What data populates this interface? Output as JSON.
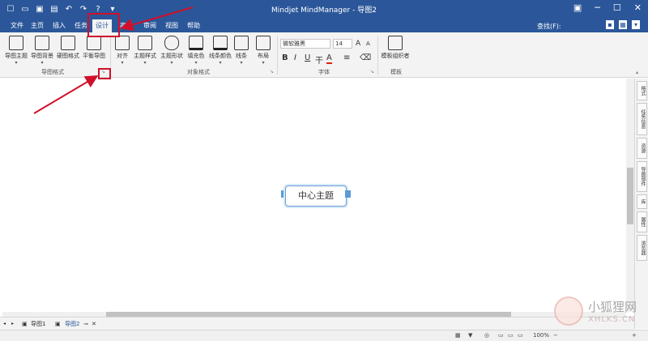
{
  "app": {
    "title": "Mindjet MindManager - 导图2"
  },
  "tabs": [
    "文件",
    "主页",
    "插入",
    "任务",
    "设计",
    "高级",
    "审阅",
    "视图",
    "帮助"
  ],
  "active_tab": "设计",
  "find_label": "查找(F):",
  "ribbon": {
    "buttons": [
      "导图主题",
      "导图背景",
      "硬图格式",
      "平衡导图",
      "对齐",
      "主题样式",
      "主题形状",
      "填充色",
      "线条颜色",
      "线条",
      "布局",
      "模板组织者"
    ],
    "groups": [
      "导图格式",
      "对象格式",
      "字体",
      "模板"
    ],
    "font_name": "微软雅黑",
    "font_size": "14",
    "format_buttons": [
      "B",
      "I",
      "U",
      "干"
    ],
    "font_size_up": "A",
    "font_size_down": "A"
  },
  "canvas": {
    "central_topic": "中心主题"
  },
  "side_panel": [
    "格式",
    "任务信息",
    "资源",
    "导图部件",
    "库",
    "属性",
    "浏览器"
  ],
  "doc_tabs": [
    "导图1",
    "导图2"
  ],
  "status": {
    "zoom": "100%"
  },
  "watermark": {
    "title": "小狐狸网",
    "subtitle": "XHLKS.CN"
  },
  "colors": {
    "accent": "#2b579a",
    "annotation": "#d0102b",
    "topic_border": "#6a9fd4"
  }
}
